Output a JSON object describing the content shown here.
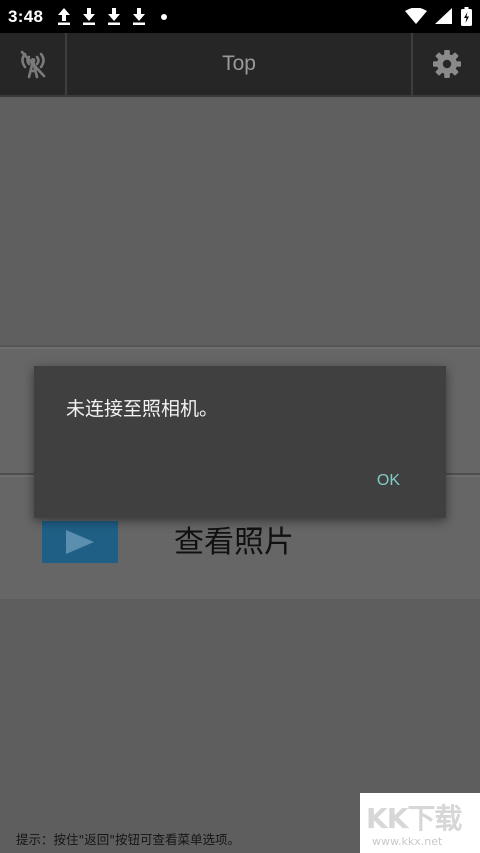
{
  "status_bar": {
    "time": "3:48",
    "icons": [
      "upload-icon",
      "download-icon",
      "download-icon",
      "download-icon",
      "dot-icon",
      "wifi-icon",
      "signal-icon",
      "battery-icon"
    ]
  },
  "toolbar": {
    "title": "Top",
    "left_icon": "no-signal-icon",
    "right_icon": "gear-icon"
  },
  "menu": {
    "view_photos_label": "查看照片",
    "view_photos_icon": "play-icon"
  },
  "hint": "提示：按住\"返回\"按钮可查看菜单选项。",
  "dialog": {
    "message": "未连接至照相机。",
    "ok_label": "OK"
  },
  "watermark": {
    "logo": "KK下载",
    "url": "www.kkx.net"
  },
  "colors": {
    "accent_ok": "#80cbc4",
    "toolbar_bg": "#262626",
    "dialog_bg": "#404040",
    "play_tile": "#1f5f86"
  }
}
